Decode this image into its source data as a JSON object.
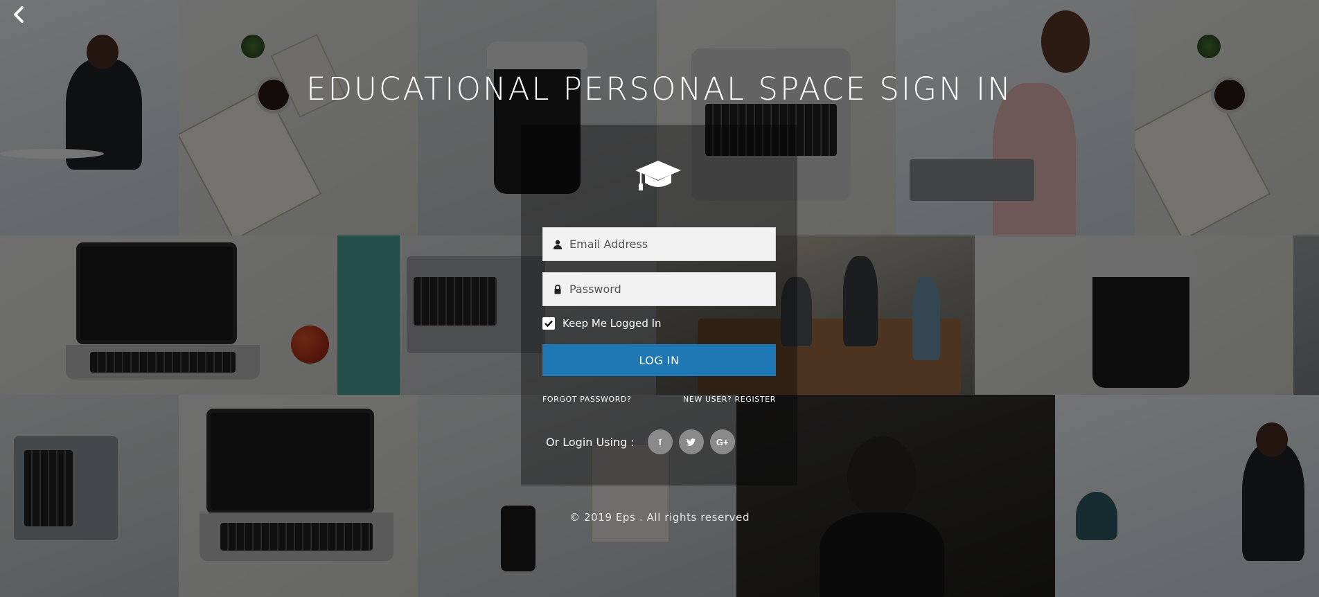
{
  "page": {
    "title": "EDUCATIONAL PERSONAL SPACE SIGN IN",
    "back_icon": "chevron-left-icon"
  },
  "login": {
    "logo_icon": "graduation-cap-icon",
    "email": {
      "placeholder": "Email Address",
      "value": "",
      "icon": "user-icon"
    },
    "password": {
      "placeholder": "Password",
      "value": "",
      "icon": "lock-icon"
    },
    "keep_logged_in": {
      "label": "Keep Me Logged In",
      "checked": true
    },
    "login_button_label": "LOG IN",
    "forgot_password_label": "FORGOT PASSWORD?",
    "register_label": "NEW USER? REGISTER",
    "social": {
      "label": "Or Login Using :",
      "buttons": [
        {
          "name": "facebook",
          "glyph": "f"
        },
        {
          "name": "twitter",
          "glyph": "🐦"
        },
        {
          "name": "google-plus",
          "glyph": "G+"
        }
      ]
    }
  },
  "footer": {
    "copyright": "© 2019 Eps . All rights reserved"
  },
  "colors": {
    "login_button": "#1f78b4",
    "panel_overlay": "rgba(0,0,0,0.35)",
    "social_button": "#8a8a8a"
  }
}
